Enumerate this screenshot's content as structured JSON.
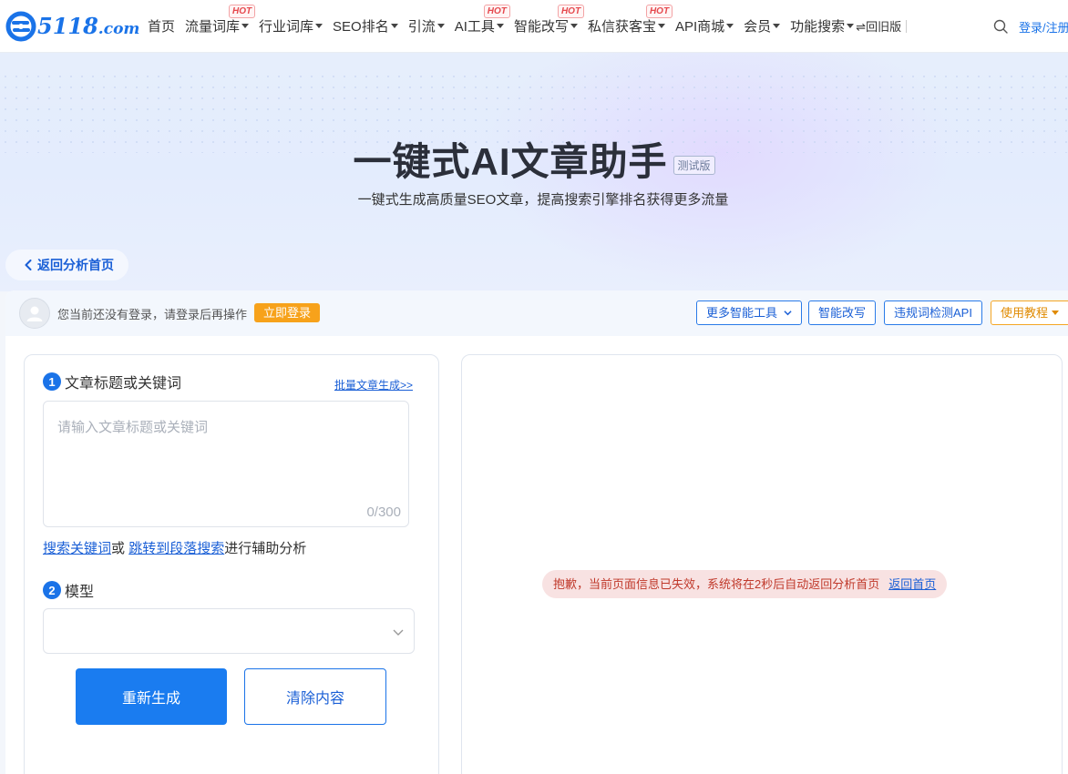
{
  "header": {
    "logo_main": "5118",
    "logo_domain": ".com",
    "nav": [
      {
        "label": "首页",
        "dropdown": false,
        "hot": false
      },
      {
        "label": "流量词库",
        "dropdown": true,
        "hot": true
      },
      {
        "label": "行业词库",
        "dropdown": true,
        "hot": false
      },
      {
        "label": "SEO排名",
        "dropdown": true,
        "hot": false
      },
      {
        "label": "引流",
        "dropdown": true,
        "hot": false
      },
      {
        "label": "AI工具",
        "dropdown": true,
        "hot": true
      },
      {
        "label": "智能改写",
        "dropdown": true,
        "hot": true
      },
      {
        "label": "私信获客宝",
        "dropdown": true,
        "hot": true
      },
      {
        "label": "API商城",
        "dropdown": true,
        "hot": false
      },
      {
        "label": "会员",
        "dropdown": true,
        "hot": false
      },
      {
        "label": "功能搜索",
        "dropdown": true,
        "hot": false
      }
    ],
    "hot_badge": "HOT",
    "old_version": "⇌回旧版",
    "login_register": "登录/注册",
    "search_icon": "search-icon"
  },
  "hero": {
    "title": "一键式AI文章助手",
    "badge": "测试版",
    "subtitle": "一键式生成高质量SEO文章，提高搜索引擎排名获得更多流量",
    "back_button": "返回分析首页"
  },
  "panel": {
    "notice": "您当前还没有登录，请登录后再操作",
    "login_now": "立即登录",
    "tools": {
      "more_tools": "更多智能工具",
      "rewrite": "智能改写",
      "violation_api": "违规词检测API",
      "tutorial": "使用教程"
    }
  },
  "form": {
    "step1_num": "1",
    "step1_label": "文章标题或关键词",
    "batch_link": "批量文章生成>>",
    "input_placeholder": "请输入文章标题或关键词",
    "input_value": "",
    "char_count": "0/300",
    "assist_link1": "搜索关键词",
    "assist_or": "或",
    "assist_link2": "跳转到段落搜索",
    "assist_suffix": "进行辅助分析",
    "step2_num": "2",
    "step2_label": "模型",
    "model_value": "",
    "regenerate": "重新生成",
    "clear": "清除内容"
  },
  "result": {
    "error_message": "抱歉，当前页面信息已失效，系统将在2秒后自动返回分析首页",
    "back_home": "返回首页"
  },
  "colors": {
    "brand": "#1a73e8",
    "login_now_bg": "#f7a21b",
    "hot": "#e5484d",
    "error_bg": "#f8e2e2",
    "error_text": "#c0392b"
  }
}
